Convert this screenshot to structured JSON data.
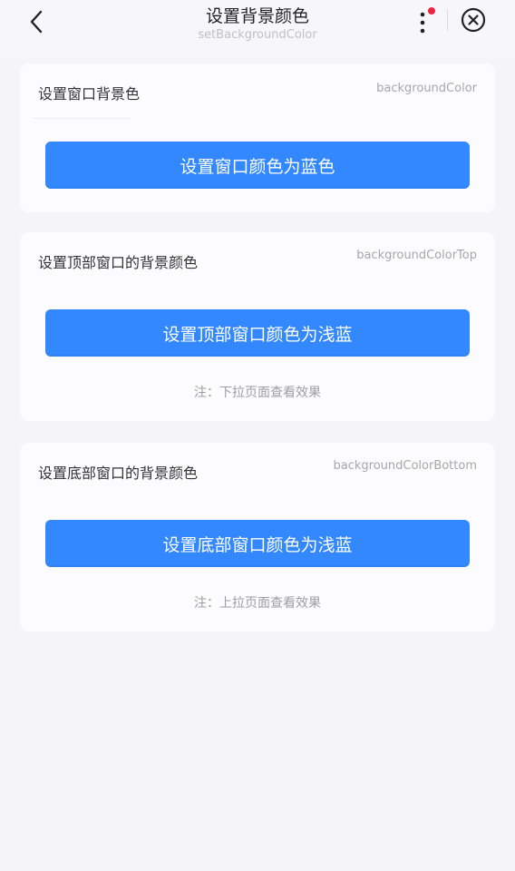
{
  "nav": {
    "title": "设置背景颜色",
    "subtitle": "setBackgroundColor",
    "notification_color": "#ee2244"
  },
  "sections": [
    {
      "label": "设置窗口背景色",
      "tag": "backgroundColor",
      "button": "设置窗口颜色为蓝色"
    },
    {
      "label": "设置顶部窗口的背景颜色",
      "tag": "backgroundColorTop",
      "button": "设置顶部窗口颜色为浅蓝",
      "note": "注：下拉页面查看效果"
    },
    {
      "label": "设置底部窗口的背景颜色",
      "tag": "backgroundColorBottom",
      "button": "设置底部窗口颜色为浅蓝",
      "note": "注：上拉页面查看效果"
    }
  ],
  "colors": {
    "button": "#3388ff",
    "page_bg": "#f5f5f7"
  }
}
